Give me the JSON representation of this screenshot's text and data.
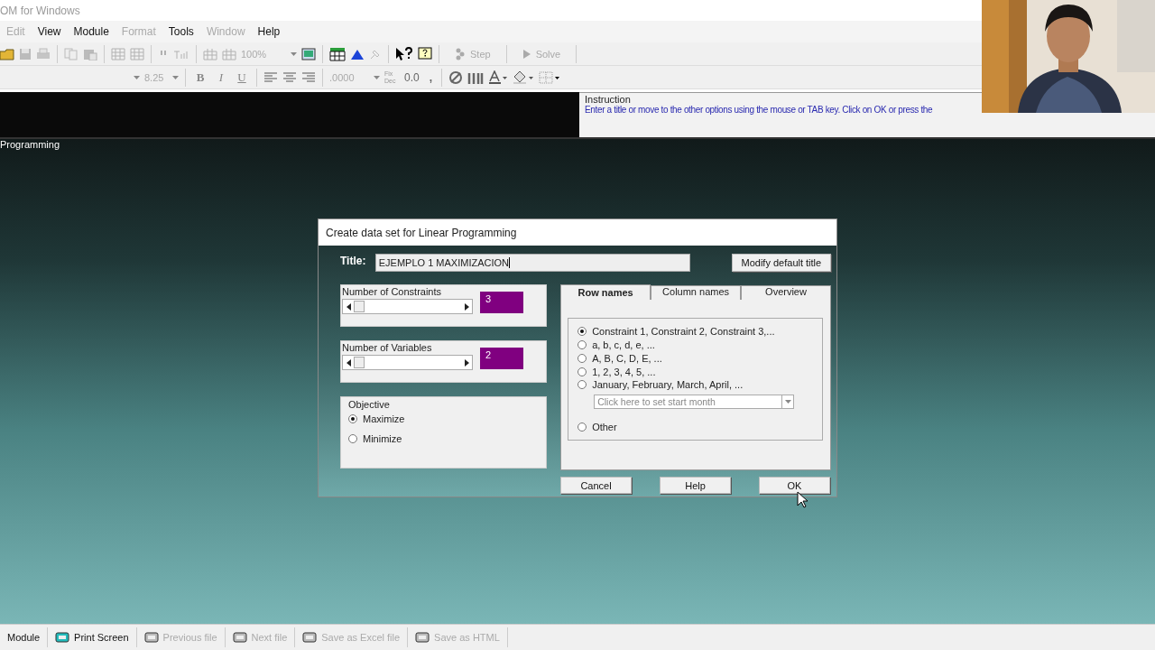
{
  "window": {
    "title": "OM for Windows"
  },
  "menu": [
    {
      "label": "Edit",
      "disabled": true
    },
    {
      "label": "View",
      "disabled": false
    },
    {
      "label": "Module",
      "disabled": false
    },
    {
      "label": "Format",
      "disabled": true
    },
    {
      "label": "Tools",
      "disabled": false
    },
    {
      "label": "Window",
      "disabled": true
    },
    {
      "label": "Help",
      "disabled": false
    }
  ],
  "toolbar": {
    "zoom": "100%",
    "actions": [
      {
        "label": "Step",
        "disabled": true
      },
      {
        "label": "Solve",
        "disabled": true
      }
    ]
  },
  "format_bar": {
    "font_size": "8.25",
    "styles": [
      "B",
      "I",
      "U"
    ],
    "number_format": ".0000",
    "fix_dec": "Fix Dec",
    "decimals": "0.0",
    "comma": ","
  },
  "instruction": {
    "label": "Instruction",
    "text": "Enter a title or move to the other options using the mouse or TAB key. Click on OK or press the"
  },
  "module_label": "Programming",
  "dialog": {
    "title": "Create data set for Linear Programming",
    "title_label": "Title:",
    "title_value": "EJEMPLO 1 MAXIMIZACION",
    "modify_button": "Modify default title",
    "counters": [
      {
        "label": "Number of Constraints",
        "value": "3"
      },
      {
        "label": "Number of Variables",
        "value": "2"
      }
    ],
    "objective": {
      "label": "Objective",
      "options": [
        {
          "label": "Maximize",
          "selected": true
        },
        {
          "label": "Minimize",
          "selected": false
        }
      ]
    },
    "tabs": [
      {
        "label": "Row names",
        "selected": true
      },
      {
        "label": "Column names",
        "selected": false
      },
      {
        "label": "Overview",
        "selected": false
      }
    ],
    "row_names": [
      {
        "label": "Constraint 1, Constraint 2, Constraint 3,...",
        "selected": true
      },
      {
        "label": "a, b, c, d, e, ...",
        "selected": false
      },
      {
        "label": "A, B, C, D, E, ...",
        "selected": false
      },
      {
        "label": "1, 2, 3, 4, 5, ...",
        "selected": false
      },
      {
        "label": "January, February, March, April, ...",
        "selected": false
      }
    ],
    "month_placeholder": "Click here to set start month",
    "other": {
      "label": "Other",
      "selected": false
    },
    "buttons": [
      "Cancel",
      "Help",
      "OK"
    ]
  },
  "status_bar": [
    {
      "label": "Module",
      "disabled": false
    },
    {
      "label": "Print Screen",
      "disabled": false
    },
    {
      "label": "Previous file",
      "disabled": true
    },
    {
      "label": "Next file",
      "disabled": true
    },
    {
      "label": "Save as Excel file",
      "disabled": true
    },
    {
      "label": "Save as HTML",
      "disabled": true
    }
  ]
}
